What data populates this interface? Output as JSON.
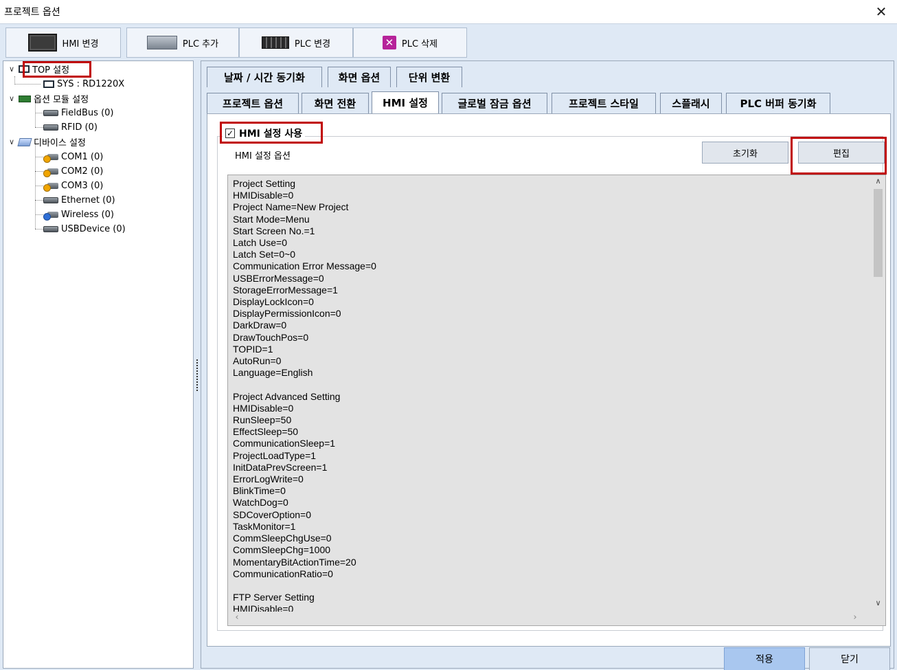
{
  "window": {
    "title": "프로젝트 옵션",
    "close_glyph": "✕"
  },
  "toolbar": {
    "hmi_change": "HMI 변경",
    "plc_add": "PLC 추가",
    "plc_change": "PLC 변경",
    "plc_delete": "PLC 삭제"
  },
  "tree": {
    "top_setting": "TOP 설정",
    "sys": "SYS : RD1220X",
    "option_module": "옵션 모듈 설정",
    "fieldbus": "FieldBus (0)",
    "rfid": "RFID (0)",
    "device_setting": "디바이스 설정",
    "com1": "COM1 (0)",
    "com2": "COM2 (0)",
    "com3": "COM3 (0)",
    "ethernet": "Ethernet (0)",
    "wireless": "Wireless (0)",
    "usbdevice": "USBDevice (0)"
  },
  "tabs_row1": [
    "날짜 / 시간 동기화",
    "화면 옵션",
    "단위 변환"
  ],
  "tabs_row2": [
    "프로젝트 옵션",
    "화면 전환",
    "HMI 설정",
    "글로벌 잠금 옵션",
    "프로젝트 스타일",
    "스플래시",
    "PLC 버퍼 동기화"
  ],
  "active_tab": "HMI 설정",
  "hmi": {
    "use_checkbox": "HMI 설정 사용",
    "checked": true,
    "options_label": "HMI 설정 옵션",
    "reset_button": "초기화",
    "edit_button": "편집",
    "text": "Project Setting\nHMIDisable=0\nProject Name=New Project\nStart Mode=Menu\nStart Screen No.=1\nLatch Use=0\nLatch Set=0~0\nCommunication Error Message=0\nUSBErrorMessage=0\nStorageErrorMessage=1\nDisplayLockIcon=0\nDisplayPermissionIcon=0\nDarkDraw=0\nDrawTouchPos=0\nTOPID=1\nAutoRun=0\nLanguage=English\n\nProject Advanced Setting\nHMIDisable=0\nRunSleep=50\nEffectSleep=50\nCommunicationSleep=1\nProjectLoadType=1\nInitDataPrevScreen=1\nErrorLogWrite=0\nBlinkTime=0\nWatchDog=0\nSDCoverOption=0\nTaskMonitor=1\nCommSleepChgUse=0\nCommSleepChg=1000\nMomentaryBitActionTime=20\nCommunicationRatio=0\n\nFTP Server Setting\nHMIDisable=0"
  },
  "footer": {
    "apply": "적용",
    "close": "닫기"
  },
  "colors": {
    "highlight_box": "#c00000",
    "apply_bg": "#a9c7ef",
    "panel_bg": "#dfe9f5"
  }
}
